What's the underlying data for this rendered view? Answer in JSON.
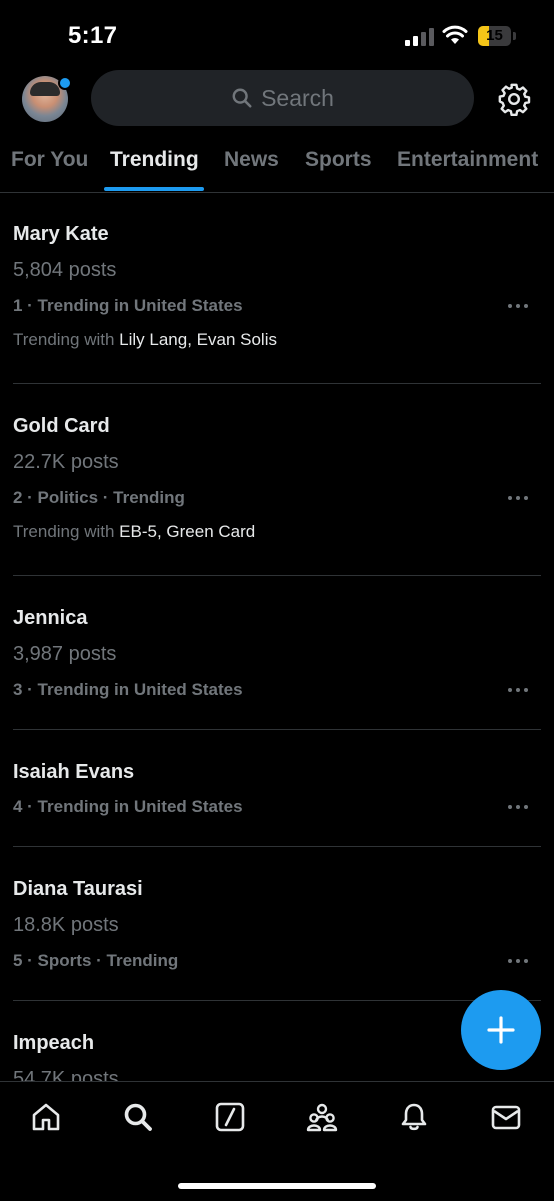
{
  "status": {
    "time": "5:17",
    "battery": "15",
    "battery_level": 0.15
  },
  "header": {
    "search_placeholder": "Search"
  },
  "tabs": [
    {
      "label": "For You"
    },
    {
      "label": "Trending"
    },
    {
      "label": "News"
    },
    {
      "label": "Sports"
    },
    {
      "label": "Entertainment"
    }
  ],
  "active_tab": "Trending",
  "trends": [
    {
      "name": "Mary Kate",
      "posts": "5,804 posts",
      "meta": "1 · Trending in United States",
      "with_label": "Trending with",
      "with_names": "Lily Lang, Evan Solis"
    },
    {
      "name": "Gold Card",
      "posts": "22.7K posts",
      "meta": "2 · Politics · Trending",
      "with_label": "Trending with",
      "with_names": "EB-5, Green Card"
    },
    {
      "name": "Jennica",
      "posts": "3,987 posts",
      "meta": "3 · Trending in United States"
    },
    {
      "name": "Isaiah Evans",
      "meta": "4 · Trending in United States"
    },
    {
      "name": "Diana Taurasi",
      "posts": "18.8K posts",
      "meta": "5 · Sports · Trending"
    },
    {
      "name": "Impeach",
      "posts": "54.7K posts"
    }
  ],
  "colors": {
    "accent": "#1d9bf0",
    "background": "#000000",
    "muted": "#71767b"
  },
  "nav": [
    "home-icon",
    "search-icon",
    "grok-icon",
    "communities-icon",
    "notifications-icon",
    "messages-icon"
  ]
}
